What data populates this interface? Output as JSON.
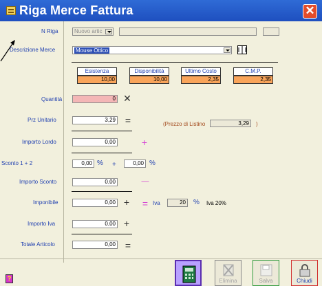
{
  "window": {
    "title": "Riga Merce Fattura",
    "close_symbol": "✕"
  },
  "labels": {
    "n_riga": "N Riga",
    "descrizione": "Descrizione Merce",
    "quantita": "Quantità",
    "prz_unitario": "Prz Unitario",
    "importo_lordo": "Importo Lordo",
    "sconto": "Sconto 1 + 2",
    "importo_sconto": "Importo Sconto",
    "imponibile": "Imponibile",
    "importo_iva": "Importo Iva",
    "totale_articolo": "Totale Articolo"
  },
  "fields": {
    "n_riga_value": "Nuovo artic",
    "descrizione_value": "Mouse Ottico",
    "quantita": "0",
    "prz_unitario": "3,29",
    "importo_lordo": "0,00",
    "sconto1": "0,00",
    "sconto2": "0,00",
    "importo_sconto": "0,00",
    "imponibile": "0,00",
    "iva_aliquota": "20",
    "importo_iva": "0,00",
    "totale_articolo": "0,00",
    "prezzo_listino": "3,29"
  },
  "stock": {
    "headers": [
      "Esistenza",
      "Disponibilità",
      "Ultimo Costo",
      "C.M.P."
    ],
    "values": [
      "10,00",
      "10,00",
      "2,35",
      "2,35"
    ]
  },
  "text": {
    "prezzo_listino_label": "(Prezzo di Listino",
    "prezzo_listino_close": ")",
    "pct": "%",
    "plus": "+",
    "iva_label": "Iva",
    "iva_desc": "Iva 20%",
    "times": "✕",
    "equals": "=",
    "minus": "—"
  },
  "buttons": {
    "elimina": "Elimina",
    "salva": "Salva",
    "chiudi": "Chiudi",
    "help": "?"
  },
  "colors": {
    "title_bar": "#1e4fbf",
    "label_blue": "#1f3fb0",
    "orange": "#f9a45a",
    "pink": "#f4b6b6",
    "plus_pink": "#d43fd4"
  }
}
